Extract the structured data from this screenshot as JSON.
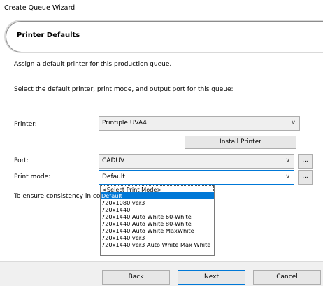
{
  "window": {
    "title": "Create Queue Wizard"
  },
  "header": {
    "title": "Printer Defaults"
  },
  "description": {
    "line1": "Assign a default printer for this production queue.",
    "line2": "Select the default printer, print mode, and output port for this queue:"
  },
  "printer": {
    "label": "Printer:",
    "value": "Printiple UVA4"
  },
  "install_printer_label": "Install Printer",
  "port": {
    "label": "Port:",
    "value": "CADUV",
    "browse_label": "..."
  },
  "print_mode": {
    "label": "Print mode:",
    "value": "Default",
    "browse_label": "...",
    "options": [
      "<Select Print Mode>",
      "Default",
      "720x1080 ver3",
      "720x1440",
      "720x1440 Auto White 60-White",
      "720x1440 Auto White 80-White",
      "720x1440 Auto White MaxWhite",
      "720x1440 ver3",
      "720x1440 ver3 Auto White Max White"
    ],
    "selected_index": 1
  },
  "consistency_note": "To ensure consistency in colo",
  "footer": {
    "back_label": "Back",
    "next_label": "Next",
    "cancel_label": "Cancel"
  },
  "icons": {
    "chevron": "chevron-down-icon"
  },
  "colors": {
    "accent": "#0078d7"
  }
}
